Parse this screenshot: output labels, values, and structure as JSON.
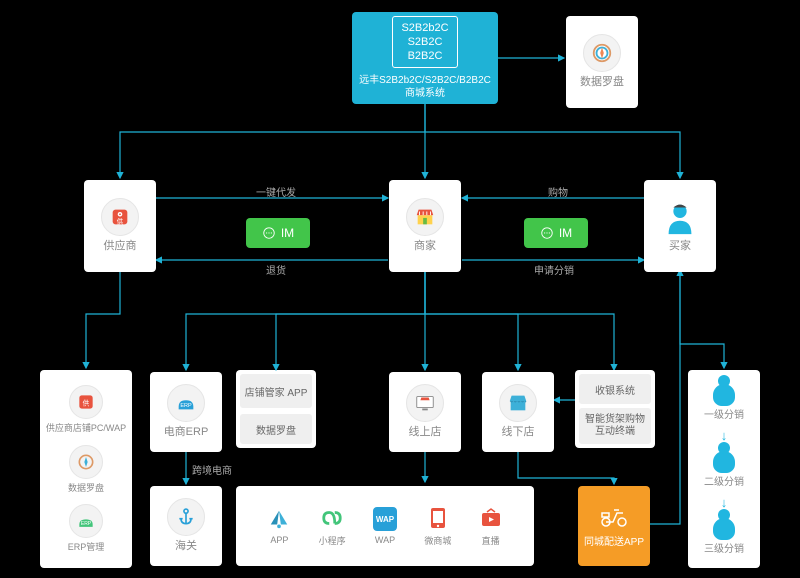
{
  "top": {
    "main_models": "S2B2b2C\nS2B2C\nB2B2C",
    "main_caption": "远丰S2B2b2C/S2B2C/B2B2C\n商城系统",
    "compass": "数据罗盘"
  },
  "mid": {
    "supplier": "供应商",
    "merchant": "商家",
    "buyer": "买家",
    "im1": "IM",
    "im2": "IM",
    "edge_send": "一键代发",
    "edge_return": "退货",
    "edge_shop": "购物",
    "edge_dist": "申请分销"
  },
  "left": {
    "a": "供应商店铺PC/WAP",
    "b": "数据罗盘",
    "c": "ERP管理"
  },
  "bottom": {
    "erp": "电商ERP",
    "hai": "海关",
    "edge_cross": "跨境电商",
    "shop_app": "店铺管家\nAPP",
    "compass": "数据罗盘",
    "online": "线上店",
    "offline": "线下店",
    "pos": "收银系统",
    "smart": "智能货架购物\n互动终端",
    "delivery": "同城配送APP",
    "apps": {
      "a1": "APP",
      "a2": "小程序",
      "a3": "WAP",
      "a4": "微商城",
      "a5": "直播"
    }
  },
  "right": {
    "l1": "一级分销",
    "l2": "二级分销",
    "l3": "三级分销"
  }
}
